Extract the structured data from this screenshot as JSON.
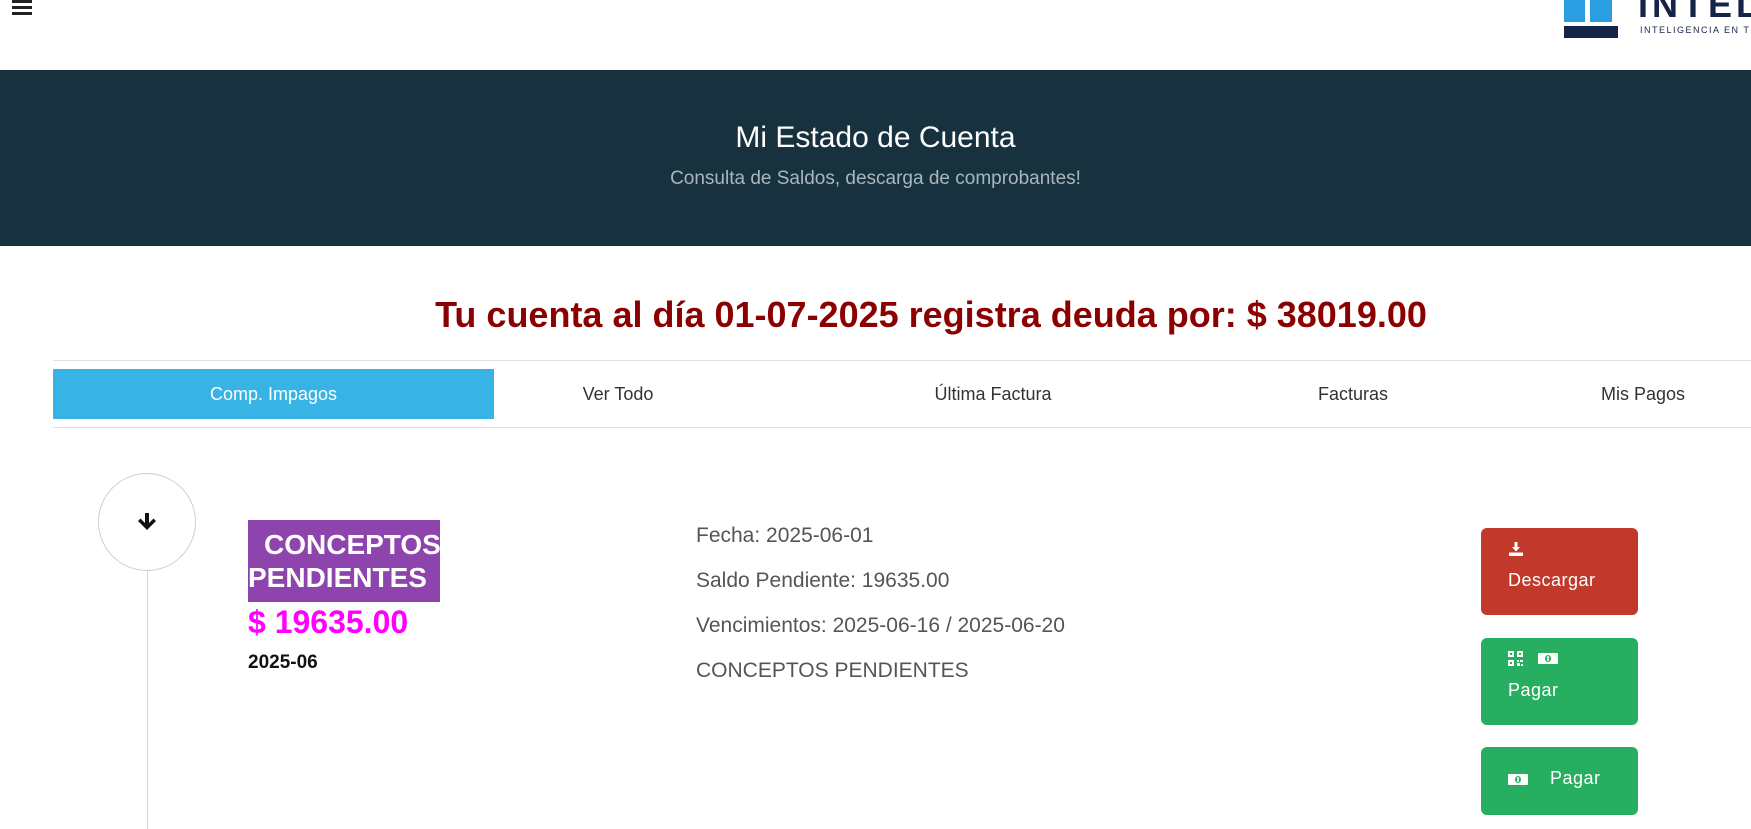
{
  "header": {
    "menu_icon": "hamburger-icon",
    "logo": {
      "word": "INTEL",
      "tagline": "INTELIGENCIA EN TEL"
    }
  },
  "hero": {
    "title": "Mi Estado de Cuenta",
    "subtitle": "Consulta de Saldos, descarga de comprobantes!"
  },
  "summary": {
    "debt_text": "Tu cuenta al día 01-07-2025 registra deuda por: $ 38019.00"
  },
  "tabs": [
    {
      "label": "Comp. Impagos",
      "active": true
    },
    {
      "label": "Ver Todo",
      "active": false
    },
    {
      "label": "Última Factura",
      "active": false
    },
    {
      "label": "Facturas",
      "active": false
    },
    {
      "label": "Mis Pagos",
      "active": false
    }
  ],
  "invoice": {
    "badge_line1": "CONCEPTOS",
    "badge_line2": "PENDIENTES",
    "amount": "$ 19635.00",
    "period": "2025-06",
    "fecha": "Fecha: 2025-06-01",
    "saldo": "Saldo Pendiente: 19635.00",
    "vencimientos": "Vencimientos: 2025-06-16 / 2025-06-20",
    "concepto": "CONCEPTOS PENDIENTES",
    "actions": {
      "download_label": "Descargar",
      "pay_qr_label": "Pagar",
      "pay_label": "Pagar"
    }
  },
  "colors": {
    "hero_bg": "#17323e",
    "debt_text": "#8b0000",
    "active_tab": "#37b3e5",
    "badge": "#8e44ad",
    "amount": "#ff00ff",
    "download_btn": "#c0392b",
    "pay_btn": "#27ae60"
  }
}
